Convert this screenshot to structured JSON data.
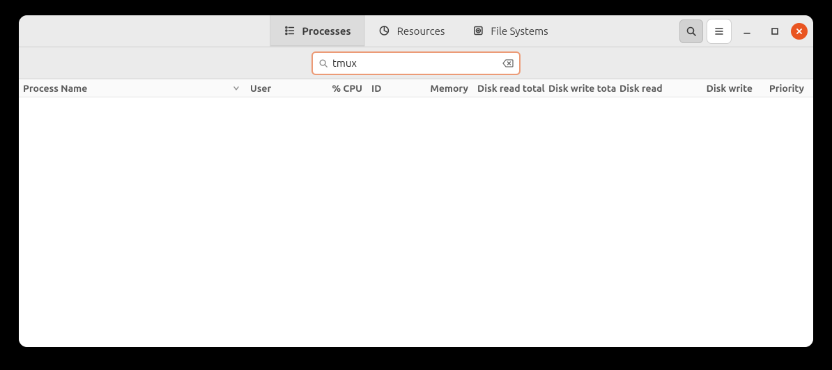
{
  "tabs": {
    "processes": "Processes",
    "resources": "Resources",
    "filesystems": "File Systems",
    "active": "processes"
  },
  "search": {
    "value": "tmux",
    "placeholder": ""
  },
  "columns": {
    "process_name": "Process Name",
    "user": "User",
    "cpu": "% CPU",
    "id": "ID",
    "memory": "Memory",
    "disk_read_total": "Disk read total",
    "disk_write_total": "Disk write total",
    "disk_read": "Disk read",
    "disk_write": "Disk write",
    "priority": "Priority"
  },
  "rows": []
}
